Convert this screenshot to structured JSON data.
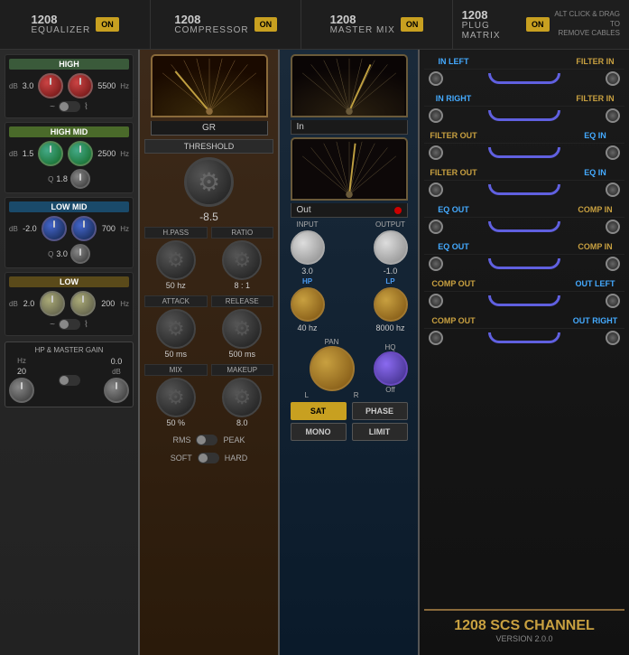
{
  "header": {
    "modules": [
      {
        "number": "1208",
        "name": "EQUALIZER",
        "on_label": "ON"
      },
      {
        "number": "1208",
        "name": "COMPRESSOR",
        "on_label": "ON"
      },
      {
        "number": "1208",
        "name": "MASTER MIX",
        "on_label": "ON"
      },
      {
        "number": "1208",
        "name": "PLUG MATRIX",
        "on_label": "ON"
      }
    ],
    "alt_click_text": "ALT CLICK & DRAG TO\nREMOVE CABLES"
  },
  "equalizer": {
    "bands": [
      {
        "id": "high",
        "label": "HIGH",
        "db_label": "dB",
        "db_value": "3.0",
        "freq_value": "5500",
        "freq_label": "Hz",
        "knob_color": "red"
      },
      {
        "id": "high-mid",
        "label": "HIGH MID",
        "db_label": "dB",
        "db_value": "1.5",
        "freq_value": "2500",
        "freq_label": "Hz",
        "q_label": "Q",
        "q_value": "1.8",
        "knob_color": "green"
      },
      {
        "id": "low-mid",
        "label": "LOW MID",
        "db_label": "dB",
        "db_value": "-2.0",
        "freq_value": "700",
        "freq_label": "Hz",
        "q_label": "Q",
        "q_value": "3.0",
        "knob_color": "blue"
      },
      {
        "id": "low",
        "label": "LOW",
        "db_label": "dB",
        "db_value": "2.0",
        "freq_value": "200",
        "freq_label": "Hz",
        "knob_color": "tan"
      }
    ],
    "hp_master": {
      "label": "HP & MASTER GAIN",
      "hp_label": "Hz",
      "hp_value": "20",
      "gain_label": "dB",
      "gain_value": "0.0"
    }
  },
  "compressor": {
    "vu_label": "GR",
    "threshold_label": "THRESHOLD",
    "threshold_value": "-8.5",
    "sections": [
      {
        "left_label": "H.PASS",
        "right_label": "RATIO",
        "left_value": "50 hz",
        "right_value": "8 : 1"
      },
      {
        "left_label": "ATTACK",
        "right_label": "RELEASE",
        "left_value": "50 ms",
        "right_value": "500 ms"
      },
      {
        "left_label": "MIX",
        "right_label": "MAKEUP",
        "left_value": "50 %",
        "right_value": "8.0"
      }
    ],
    "rms_label": "RMS",
    "peak_label": "PEAK",
    "soft_label": "SOFT",
    "hard_label": "HARD"
  },
  "master_mix": {
    "in_label": "In",
    "out_label": "Out",
    "input_label": "INPUT",
    "output_label": "OUTPUT",
    "input_value": "3.0",
    "output_value": "-1.0",
    "hp_filter_label": "HP",
    "hp_filter_value": "40 hz",
    "lp_filter_label": "LP",
    "lp_filter_value": "8000 hz",
    "pan_label": "PAN",
    "pan_lr_left": "L",
    "pan_lr_right": "R",
    "hq_label": "HQ",
    "hq_value": "Off",
    "sat_label": "SAT",
    "phase_label": "PHASE",
    "mono_label": "MONO",
    "limit_label": "LIMIT"
  },
  "plug_matrix": {
    "rows": [
      {
        "left": "IN LEFT",
        "right": "FILTER IN",
        "left_color": "blue",
        "right_color": "gold",
        "cable": true
      },
      {
        "left": "IN RIGHT",
        "right": "FILTER IN",
        "left_color": "blue",
        "right_color": "gold",
        "cable": true
      },
      {
        "left": "FILTER OUT",
        "right": "EQ IN",
        "left_color": "gold",
        "right_color": "blue",
        "cable": true
      },
      {
        "left": "FILTER OUT",
        "right": "EQ IN",
        "left_color": "gold",
        "right_color": "blue",
        "cable": true
      },
      {
        "left": "EQ OUT",
        "right": "COMP IN",
        "left_color": "blue",
        "right_color": "gold",
        "cable": true
      },
      {
        "left": "EQ OUT",
        "right": "COMP IN",
        "left_color": "blue",
        "right_color": "gold",
        "cable": true
      },
      {
        "left": "COMP OUT",
        "right": "OUT LEFT",
        "left_color": "gold",
        "right_color": "blue",
        "cable": true
      },
      {
        "left": "COMP OUT",
        "right": "OUT RIGHT",
        "left_color": "gold",
        "right_color": "blue",
        "cable": true
      }
    ],
    "footer": {
      "brand": "1208 SCS Channel",
      "brand_number": "1208",
      "brand_name": " SCS CHANNEL",
      "version": "VERSION 2.0.0"
    }
  }
}
